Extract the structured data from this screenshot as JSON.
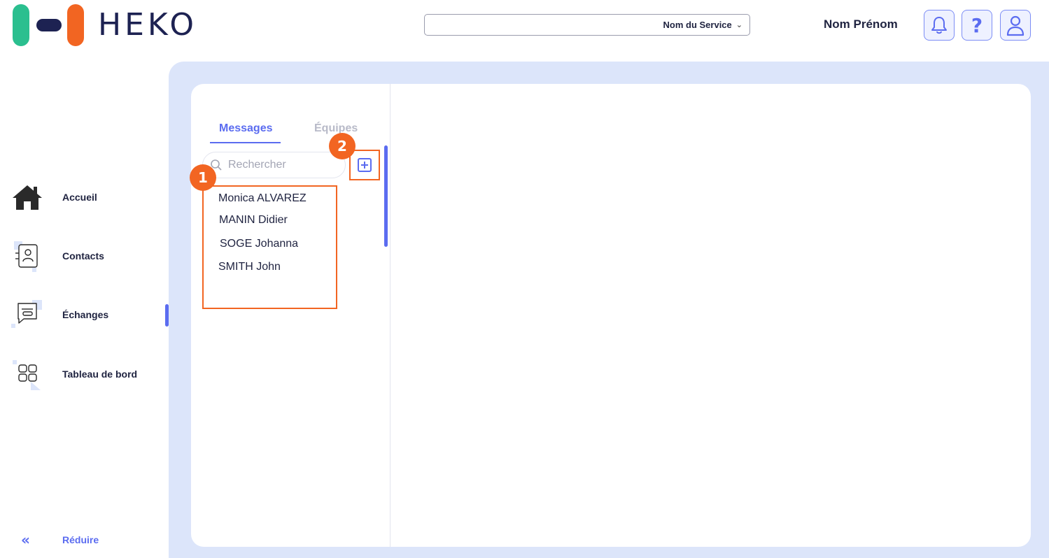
{
  "brand": {
    "name": "HEKO"
  },
  "header": {
    "service_select": "Nom du Service",
    "user_name": "Nom Prénom"
  },
  "sidebar": {
    "items": [
      {
        "label": "Accueil",
        "icon": "home-icon"
      },
      {
        "label": "Contacts",
        "icon": "contact-card-icon"
      },
      {
        "label": "Échanges",
        "icon": "chat-icon",
        "active": true
      },
      {
        "label": "Tableau de bord",
        "icon": "dashboard-grid-icon"
      }
    ],
    "collapse_label": "Réduire"
  },
  "messages_panel": {
    "tabs": [
      {
        "label": "Messages",
        "active": true
      },
      {
        "label": "Équipes",
        "active": false
      }
    ],
    "search_placeholder": "Rechercher",
    "contacts": [
      "Monica ALVAREZ",
      "MANIN Didier",
      "SOGE Johanna",
      "SMITH John"
    ]
  },
  "annotations": {
    "badge_1": "1",
    "badge_2": "2"
  },
  "colors": {
    "accent": "#5b6cf0",
    "highlight": "#f26522",
    "brand_green": "#2bbf8f",
    "brand_navy": "#1d2252",
    "panel_bg": "#dce5fa"
  }
}
